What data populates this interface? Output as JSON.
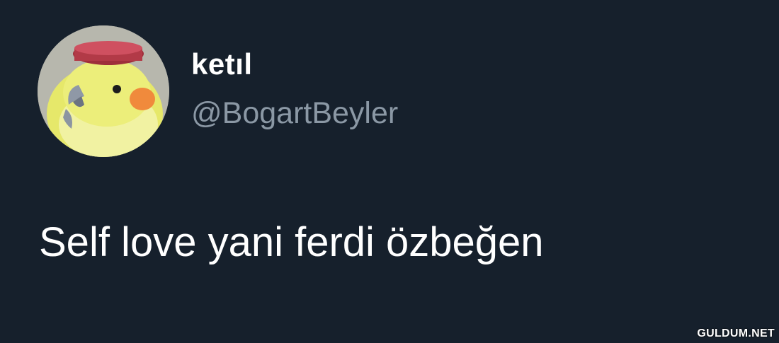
{
  "tweet": {
    "avatar_icon": "cockatiel-avatar-icon",
    "display_name": "ketıl",
    "handle": "@BogartBeyler",
    "text": "Self love yani ferdi özbeğen"
  },
  "watermark": "GULDUM.NET",
  "colors": {
    "background": "#16202c",
    "display_name": "#ffffff",
    "handle": "#8b98a5",
    "text": "#ffffff"
  }
}
